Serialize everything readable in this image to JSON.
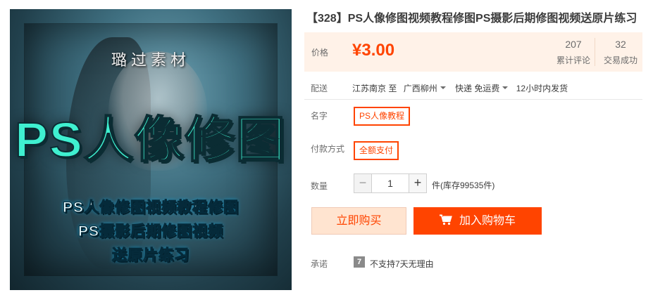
{
  "product": {
    "title": "【328】PS人像修图视频教程修图PS摄影后期修图视频送原片练习",
    "image": {
      "watermark": "璐过素材",
      "big_title": "PS人像修图",
      "line1": "PS人像修图视频教程修图",
      "line2": "PS摄影后期修图视频",
      "line3": "送原片练习"
    }
  },
  "price": {
    "label": "价格",
    "value": "¥3.00",
    "reviews_count": "207",
    "reviews_label": "累计评论",
    "sales_count": "32",
    "sales_label": "交易成功"
  },
  "shipping": {
    "label": "配送",
    "from": "江苏南京 至",
    "to": "广西柳州",
    "method": "快递 免运费",
    "dispatch": "12小时内发货"
  },
  "options": {
    "name_label": "名字",
    "name_value": "PS人像教程",
    "pay_label": "付款方式",
    "pay_value": "全额支付"
  },
  "quantity": {
    "label": "数量",
    "minus": "−",
    "value": "1",
    "plus": "+",
    "stock": "件(库存99535件)"
  },
  "actions": {
    "buy_now": "立即购买",
    "add_to_cart": "加入购物车"
  },
  "promise": {
    "label": "承诺",
    "icon_text": "7",
    "text": "不支持7天无理由"
  },
  "colors": {
    "accent": "#ff4400",
    "price_bg": "#fff2e8",
    "buy_now_bg": "#ffe4d0"
  }
}
